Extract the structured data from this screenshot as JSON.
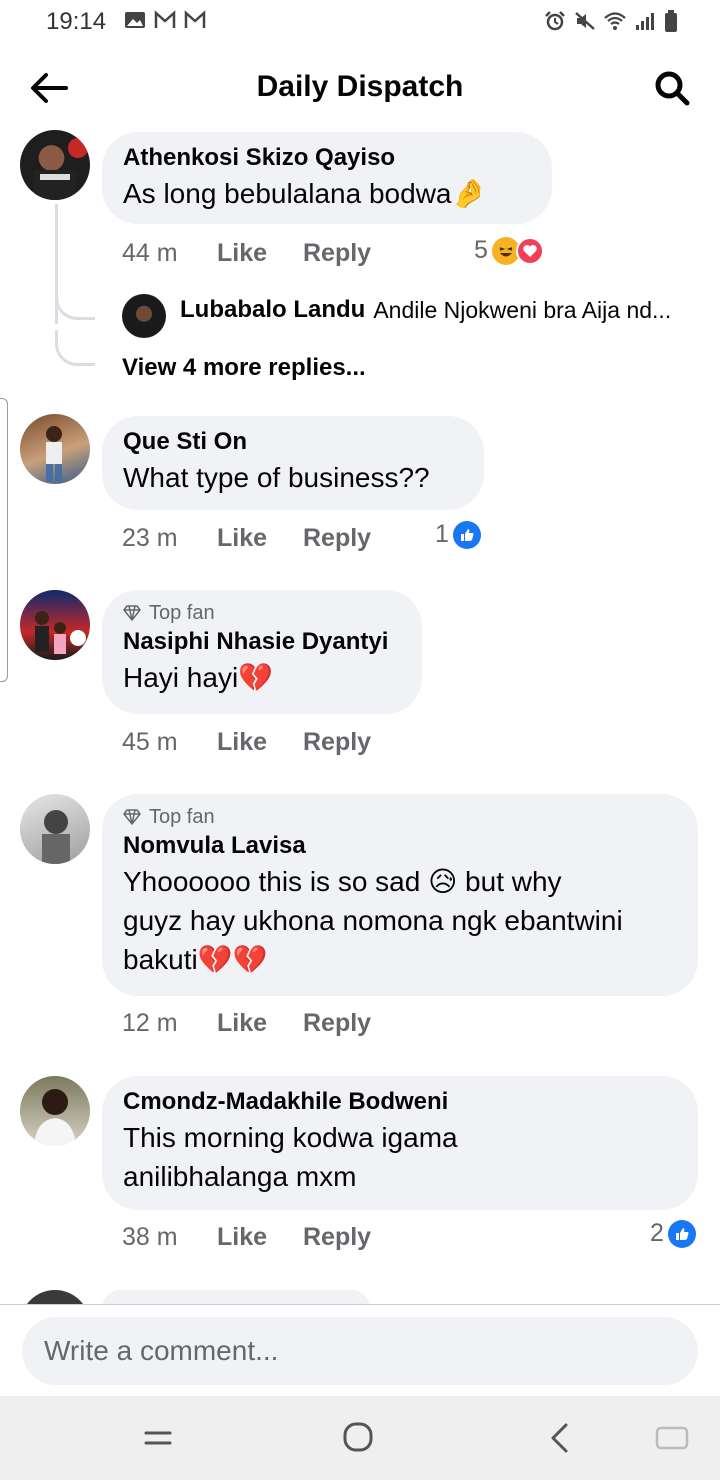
{
  "status_bar": {
    "time": "19:14"
  },
  "header": {
    "title": "Daily Dispatch"
  },
  "colors": {
    "bubble": "#f0f2f5",
    "secondary_text": "#65676b",
    "like_blue": "#1877f2",
    "haha_yellow": "#f7b125",
    "love_red": "#f33e58"
  },
  "comments": [
    {
      "author": "Athenkosi Skizo Qayiso",
      "text": "As long bebulalana bodwa🤌",
      "time": "44 m",
      "like": "Like",
      "reply": "Reply",
      "reaction_count": "5",
      "reactions": [
        "haha-icon",
        "love-icon"
      ],
      "reply_preview": {
        "author": "Lubabalo Landu",
        "text": "Andile Njokweni bra Aija nd..."
      },
      "view_more": "View 4 more replies..."
    },
    {
      "author": "Que Sti On",
      "text": "What type of business??",
      "time": "23 m",
      "like": "Like",
      "reply": "Reply",
      "reaction_count": "1",
      "reactions": [
        "like-icon"
      ]
    },
    {
      "badge": "Top fan",
      "author": "Nasiphi Nhasie Dyantyi",
      "text": "Hayi hayi💔",
      "time": "45 m",
      "like": "Like",
      "reply": "Reply"
    },
    {
      "badge": "Top fan",
      "author": "Nomvula Lavisa",
      "text_lines": [
        "Yhoooooo this is so sad 😥 but why",
        "guyz hay ukhona nomona ngk ebantwini",
        "bakuti💔💔"
      ],
      "time": "12 m",
      "like": "Like",
      "reply": "Reply"
    },
    {
      "author": "Cmondz-Madakhile Bodweni",
      "text_lines": [
        "This morning kodwa igama",
        "anilibhalanga mxm"
      ],
      "time": "38 m",
      "like": "Like",
      "reply": "Reply",
      "reaction_count": "2",
      "reactions": [
        "like-icon"
      ]
    }
  ],
  "composer": {
    "placeholder": "Write a comment..."
  }
}
